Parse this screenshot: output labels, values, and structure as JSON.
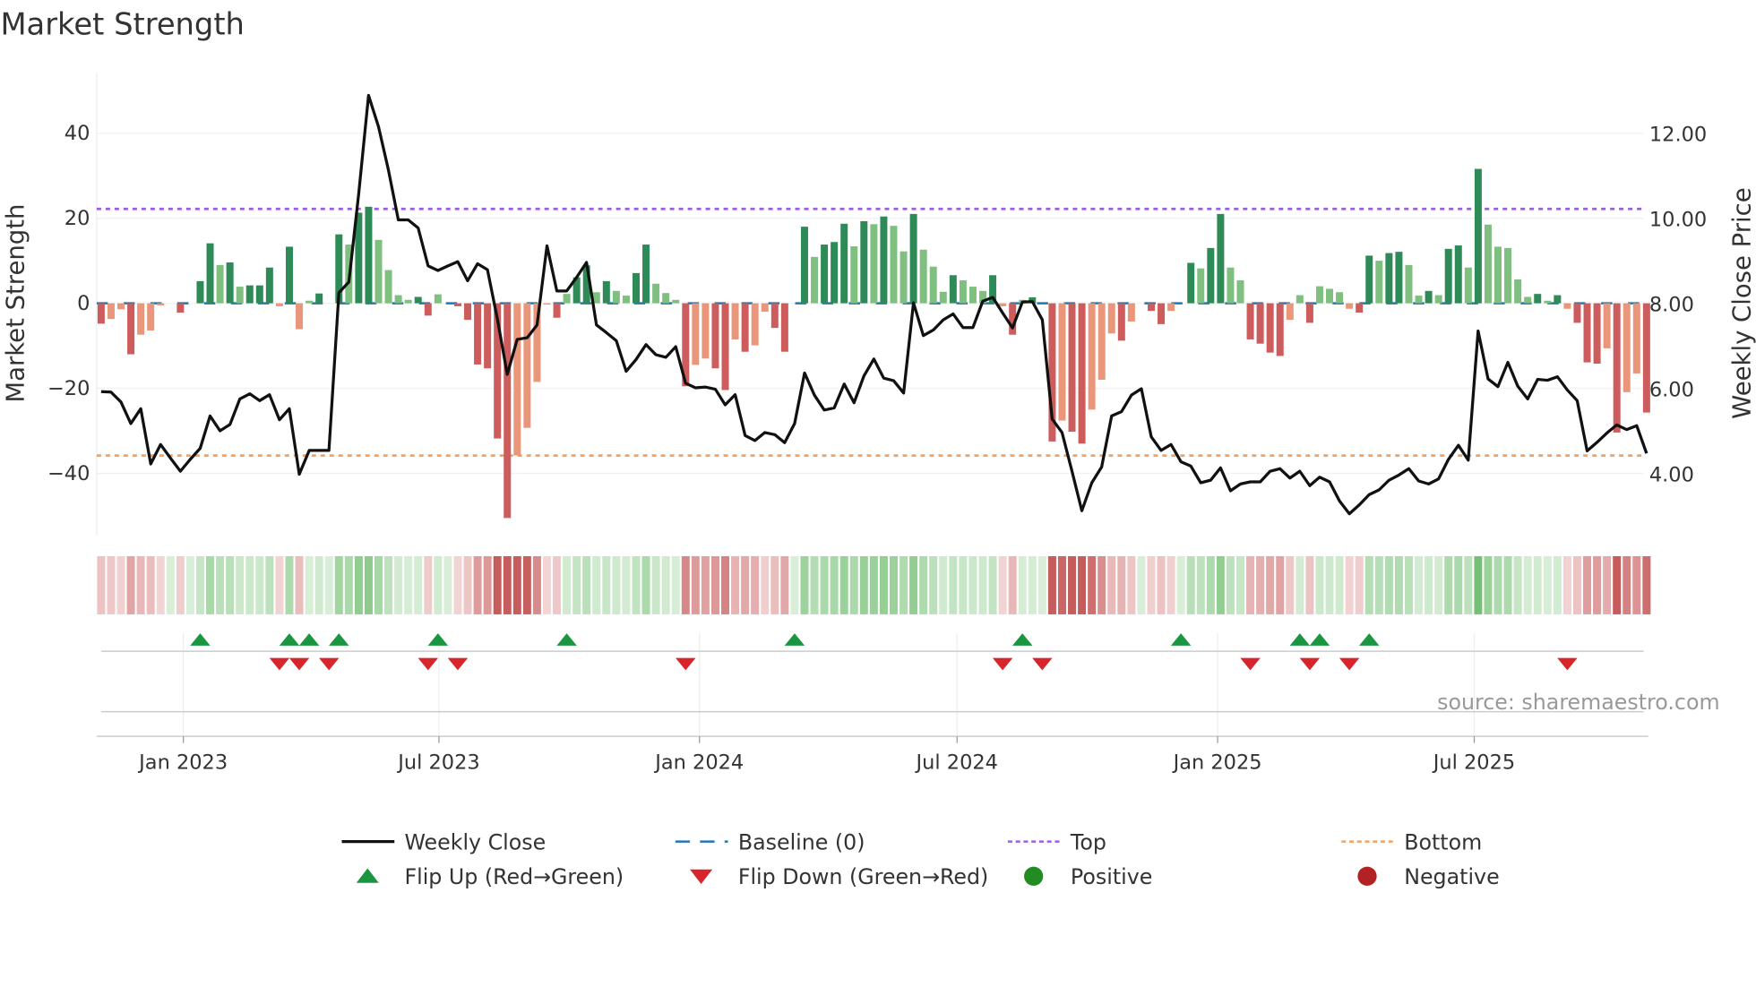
{
  "chart_data": {
    "type": "bar",
    "title": "Market Strength",
    "ylabel": "Market Strength",
    "y2label": "Weekly Close Price",
    "ylim": [
      -55,
      55
    ],
    "y_ticks": [
      40,
      20,
      0,
      -20,
      -40
    ],
    "y_tick_labels": [
      "40",
      "20",
      "0",
      "−20",
      "−40"
    ],
    "y2_ticks": [
      12,
      10,
      8,
      6,
      4
    ],
    "y2_tick_labels": [
      "12.00",
      "10.00",
      "8.00",
      "6.00",
      "4.00"
    ],
    "x_ticks": [
      {
        "week": 8.3,
        "label": "Jan 2023"
      },
      {
        "week": 34.1,
        "label": "Jul 2023"
      },
      {
        "week": 60.4,
        "label": "Jan 2024"
      },
      {
        "week": 86.4,
        "label": "Jul 2024"
      },
      {
        "week": 112.7,
        "label": "Jan 2025"
      },
      {
        "week": 138.6,
        "label": "Jul 2025"
      }
    ],
    "top_level": 22.2,
    "bottom_level": -35.8,
    "baseline": 0,
    "strength": [
      -4.8,
      -3.7,
      -1.4,
      -12,
      -7.4,
      -6.4,
      -0.5,
      0,
      -2.2,
      0,
      5.2,
      14.1,
      9,
      9.6,
      3.9,
      4.2,
      4.2,
      8.4,
      -0.7,
      13.3,
      -6.1,
      0.6,
      2.3,
      0,
      16.2,
      13.8,
      21.3,
      22.7,
      14.9,
      7.8,
      1.9,
      0.8,
      1.5,
      -2.9,
      2.1,
      0,
      -0.7,
      -3.9,
      -14.4,
      -15.3,
      -31.8,
      -50.5,
      -35.8,
      -29.3,
      -18.5,
      -0.3,
      -3.4,
      2.2,
      6.1,
      8.9,
      2.6,
      5.2,
      2.9,
      1.8,
      7.1,
      13.8,
      4.6,
      2.4,
      0.8,
      -19.5,
      -14.5,
      -13,
      -15.3,
      -20.4,
      -8.5,
      -11.4,
      -9.9,
      -2,
      -5.8,
      -11.4,
      0,
      18,
      10.9,
      13.8,
      14.4,
      18.7,
      13.4,
      19.3,
      18.6,
      20.4,
      18.2,
      12.2,
      21,
      12.6,
      8.6,
      2.7,
      6.6,
      5.4,
      3.9,
      2.9,
      6.6,
      -0.7,
      -7.4,
      0.8,
      1.4,
      0,
      -32.5,
      -27.6,
      -30.2,
      -33,
      -25,
      -18,
      -7.1,
      -8.8,
      -4.3,
      0,
      -1.8,
      -4.9,
      -1.8,
      0,
      9.5,
      8.2,
      13,
      21,
      8.4,
      5.4,
      -8.5,
      -9.5,
      -11.6,
      -12.4,
      -3.9,
      1.9,
      -4.6,
      4,
      3.4,
      2.6,
      -1.3,
      -2.2,
      11.2,
      10,
      11.8,
      12.1,
      9,
      1.8,
      2.9,
      1.9,
      12.8,
      13.6,
      8.4,
      31.6,
      18.5,
      13.3,
      13,
      5.6,
      1.5,
      2.2,
      0.6,
      1.9,
      -1.3,
      -4.6,
      -13.9,
      -14.2,
      -10.6,
      -30.4,
      -20.9,
      -16.5,
      -25.7
    ],
    "weekly_close": [
      5.92,
      5.91,
      5.68,
      5.17,
      5.52,
      4.22,
      4.68,
      4.36,
      4.05,
      4.33,
      4.59,
      5.35,
      5.0,
      5.15,
      5.75,
      5.87,
      5.71,
      5.85,
      5.26,
      5.52,
      3.98,
      4.54,
      4.54,
      4.54,
      8.25,
      8.5,
      10.58,
      12.89,
      12.15,
      11.14,
      9.96,
      9.96,
      9.77,
      8.88,
      8.77,
      8.88,
      8.98,
      8.53,
      8.93,
      8.79,
      7.63,
      6.33,
      7.15,
      7.19,
      7.49,
      9.35,
      8.29,
      8.29,
      8.61,
      8.96,
      7.49,
      7.31,
      7.12,
      6.4,
      6.68,
      7.03,
      6.79,
      6.73,
      6.98,
      6.12,
      6.01,
      6.03,
      5.98,
      5.61,
      5.85,
      4.89,
      4.77,
      4.96,
      4.91,
      4.72,
      5.17,
      6.36,
      5.84,
      5.49,
      5.54,
      6.1,
      5.66,
      6.29,
      6.69,
      6.24,
      6.18,
      5.89,
      8.01,
      7.24,
      7.37,
      7.61,
      7.75,
      7.43,
      7.43,
      8.05,
      8.14,
      7.77,
      7.42,
      8.03,
      8.04,
      7.61,
      5.28,
      4.96,
      4.05,
      3.12,
      3.78,
      4.15,
      5.35,
      5.45,
      5.84,
      5.99,
      4.86,
      4.54,
      4.68,
      4.27,
      4.17,
      3.78,
      3.84,
      4.13,
      3.59,
      3.75,
      3.8,
      3.8,
      4.05,
      4.11,
      3.89,
      4.05,
      3.71,
      3.91,
      3.8,
      3.35,
      3.05,
      3.26,
      3.5,
      3.61,
      3.84,
      3.96,
      4.11,
      3.82,
      3.75,
      3.87,
      4.33,
      4.66,
      4.31,
      7.35,
      6.22,
      6.04,
      6.61,
      6.05,
      5.75,
      6.21,
      6.19,
      6.27,
      5.96,
      5.71,
      4.53,
      4.73,
      4.95,
      5.14,
      5.03,
      5.12,
      4.47
    ],
    "flip_up_weeks": [
      10,
      19,
      21,
      24,
      34,
      47,
      70,
      93,
      109,
      121,
      123,
      128
    ],
    "flip_down_weeks": [
      18,
      20,
      23,
      33,
      36,
      59,
      91,
      95,
      116,
      122,
      126,
      148
    ],
    "legend": [
      {
        "label": "Weekly Close",
        "kind": "line"
      },
      {
        "label": "Baseline (0)",
        "kind": "dash"
      },
      {
        "label": "Top",
        "kind": "dot-purple"
      },
      {
        "label": "Bottom",
        "kind": "dot-orange"
      },
      {
        "label": "Flip Up (Red→Green)",
        "kind": "tri-up"
      },
      {
        "label": "Flip Down (Green→Red)",
        "kind": "tri-down"
      },
      {
        "label": "Positive",
        "kind": "circle-green"
      },
      {
        "label": "Negative",
        "kind": "circle-red"
      }
    ],
    "legend_position": "bottom",
    "grid": true
  },
  "source": "source: sharemaestro.com",
  "colors": {
    "pos_strong": "#2e8b57",
    "pos_weak": "#7fbf7f",
    "neg_strong": "#cd5c5c",
    "neg_weak": "#e9967a",
    "price": "#111111",
    "baseline": "#1f77b4",
    "top": "#9b5de5",
    "bottom": "#f4a261",
    "flip_up": "#1a9641",
    "flip_down": "#d7262b",
    "legend_pos": "#228b22",
    "legend_neg": "#b22222"
  }
}
